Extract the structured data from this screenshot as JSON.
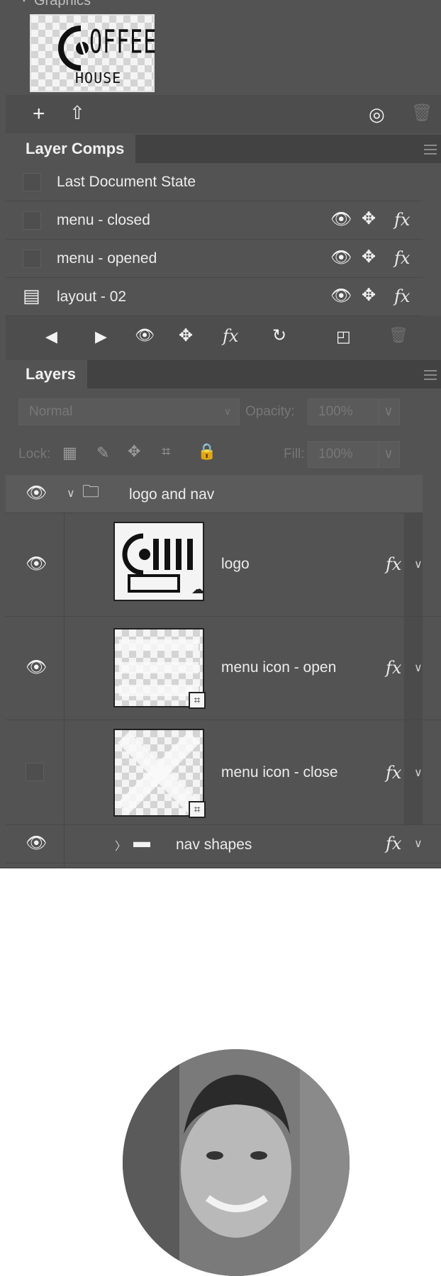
{
  "graphics": {
    "title": "Graphics",
    "thumb_text_top": "OFFEE",
    "thumb_text_bottom": "HOUSE"
  },
  "layer_comps": {
    "tab_label": "Layer Comps",
    "items": [
      {
        "label": "Last Document State",
        "applied": false
      },
      {
        "label": "menu - closed",
        "applied": false
      },
      {
        "label": "menu - opened",
        "applied": false
      },
      {
        "label": "layout - 02",
        "applied": true
      }
    ]
  },
  "layers": {
    "tab_label": "Layers",
    "blend_mode": "Normal",
    "opacity_label": "Opacity:",
    "opacity_value": "100%",
    "lock_label": "Lock:",
    "fill_label": "Fill:",
    "fill_value": "100%",
    "items": [
      {
        "name": "logo and nav",
        "type": "group",
        "visible": true,
        "expanded": true
      },
      {
        "name": "logo",
        "type": "layer",
        "visible": true,
        "fx": "fx"
      },
      {
        "name": "menu icon - open",
        "type": "shape",
        "visible": true,
        "fx": "fx"
      },
      {
        "name": "menu icon - close",
        "type": "shape",
        "visible": false,
        "fx": "fx"
      },
      {
        "name": "nav shapes",
        "type": "group",
        "visible": true,
        "expanded": false,
        "fx": "fx"
      }
    ]
  },
  "colors": {
    "panel_bg": "#535353",
    "panel_header": "#424242",
    "text": "#ececec"
  }
}
